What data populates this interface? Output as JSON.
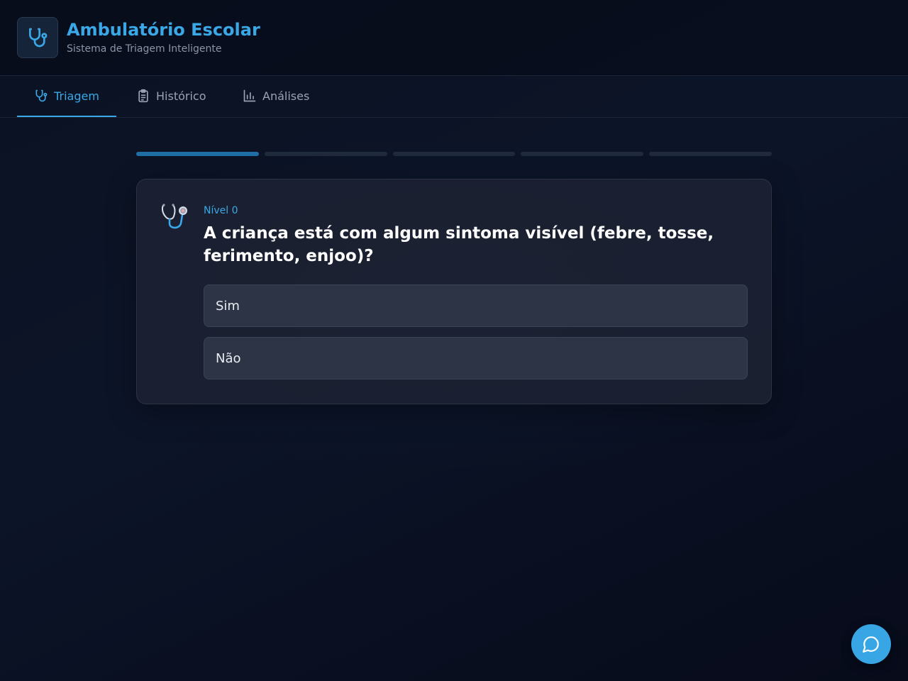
{
  "header": {
    "title": "Ambulatório Escolar",
    "subtitle": "Sistema de Triagem Inteligente",
    "logo_icon": "stethoscope-icon"
  },
  "tabs": [
    {
      "label": "Triagem",
      "icon": "stethoscope-icon",
      "active": true
    },
    {
      "label": "Histórico",
      "icon": "clipboard-icon",
      "active": false
    },
    {
      "label": "Análises",
      "icon": "bar-chart-icon",
      "active": false
    }
  ],
  "progress": {
    "completed_steps": 1,
    "total_steps": 5
  },
  "question": {
    "level": "Nível 0",
    "text": "A criança está com algum sintoma visível (febre, tosse, ferimento, enjoo)?",
    "icon": "stethoscope-emoji-icon",
    "options": [
      {
        "label": "Sim"
      },
      {
        "label": "Não"
      }
    ]
  },
  "chat_button": {
    "icon": "chat-bubble-icon"
  },
  "colors": {
    "accent": "#3aa8e6",
    "progress_done": "#1f6ea5",
    "progress_pending": "#1f2a3c",
    "card_bg": "#1c2232",
    "option_bg": "#2d3445"
  }
}
